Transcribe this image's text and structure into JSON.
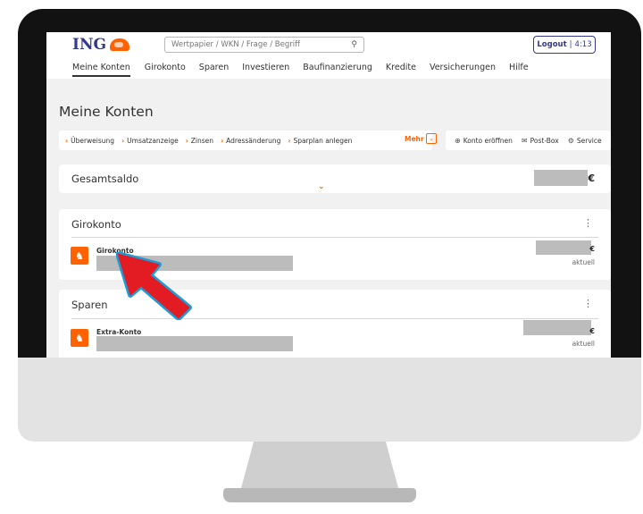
{
  "header": {
    "logo_text": "ING",
    "search_placeholder": "Wertpapier / WKN / Frage / Begriff",
    "logout_label": "Logout",
    "session_time": "4:13"
  },
  "nav": {
    "items": [
      "Meine Konten",
      "Girokonto",
      "Sparen",
      "Investieren",
      "Baufinanzierung",
      "Kredite",
      "Versicherungen",
      "Hilfe"
    ]
  },
  "page_title": "Meine Konten",
  "quicklinks": {
    "items": [
      "Überweisung",
      "Umsatzanzeige",
      "Zinsen",
      "Adressänderung",
      "Sparplan anlegen"
    ],
    "more_label": "Mehr"
  },
  "service_links": [
    "Konto eröffnen",
    "Post-Box",
    "Service"
  ],
  "gesamtsaldo": {
    "label": "Gesamtsaldo",
    "currency": "€"
  },
  "girokonto": {
    "heading": "Girokonto",
    "account_name": "Girokonto",
    "currency": "€",
    "status": "aktuell"
  },
  "sparen": {
    "heading": "Sparen",
    "account_name": "Extra-Konto",
    "currency": "€",
    "status": "aktuell"
  },
  "colors": {
    "accent": "#ff6200",
    "brand": "#333a8a",
    "bezel": "#121212",
    "redacted": "#bcbcbc"
  },
  "icons": [
    "search-icon",
    "chevron-down-icon",
    "plus-circle-icon",
    "mail-icon",
    "gear-icon",
    "kebab-menu-icon",
    "lion-logo-icon",
    "cursor-arrow-icon"
  ]
}
